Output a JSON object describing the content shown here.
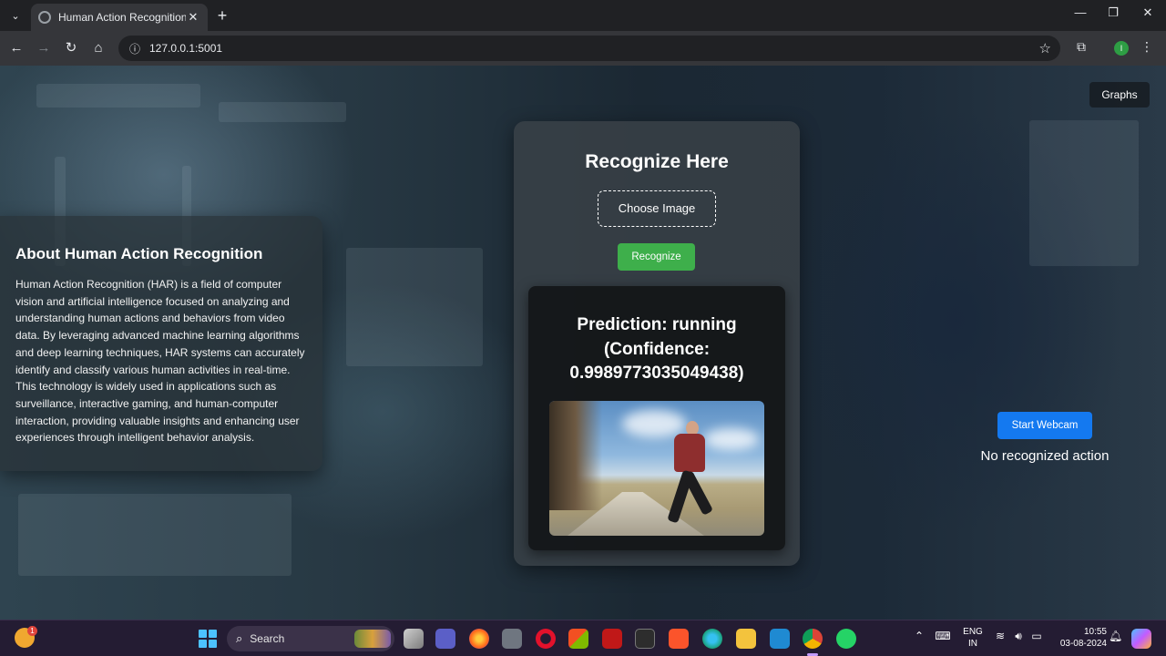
{
  "browser": {
    "tab_title": "Human Action Recognition",
    "url": "127.0.0.1:5001",
    "profile_initial": "I"
  },
  "page": {
    "graphs_link": "Graphs",
    "about": {
      "title": "About Human Action Recognition",
      "body": "Human Action Recognition (HAR) is a field of computer vision and artificial intelligence focused on analyzing and understanding human actions and behaviors from video data. By leveraging advanced machine learning algorithms and deep learning techniques, HAR systems can accurately identify and classify various human activities in real-time. This technology is widely used in applications such as surveillance, interactive gaming, and human-computer interaction, providing valuable insights and enhancing user experiences through intelligent behavior analysis."
    },
    "recognize": {
      "title": "Recognize Here",
      "choose_image_label": "Choose Image",
      "recognize_button": "Recognize",
      "prediction": "Prediction: running (Confidence: 0.9989773035049438)"
    },
    "webcam": {
      "start_button": "Start Webcam",
      "status": "No recognized action"
    }
  },
  "taskbar": {
    "weather_badge": "1",
    "search_placeholder": "Search",
    "language_line1": "ENG",
    "language_line2": "IN",
    "time": "10:55",
    "date": "03-08-2024"
  },
  "colors": {
    "recognize_button": "#3eaf4b",
    "webcam_button": "#1479f0",
    "taskbar": "#241c33"
  }
}
